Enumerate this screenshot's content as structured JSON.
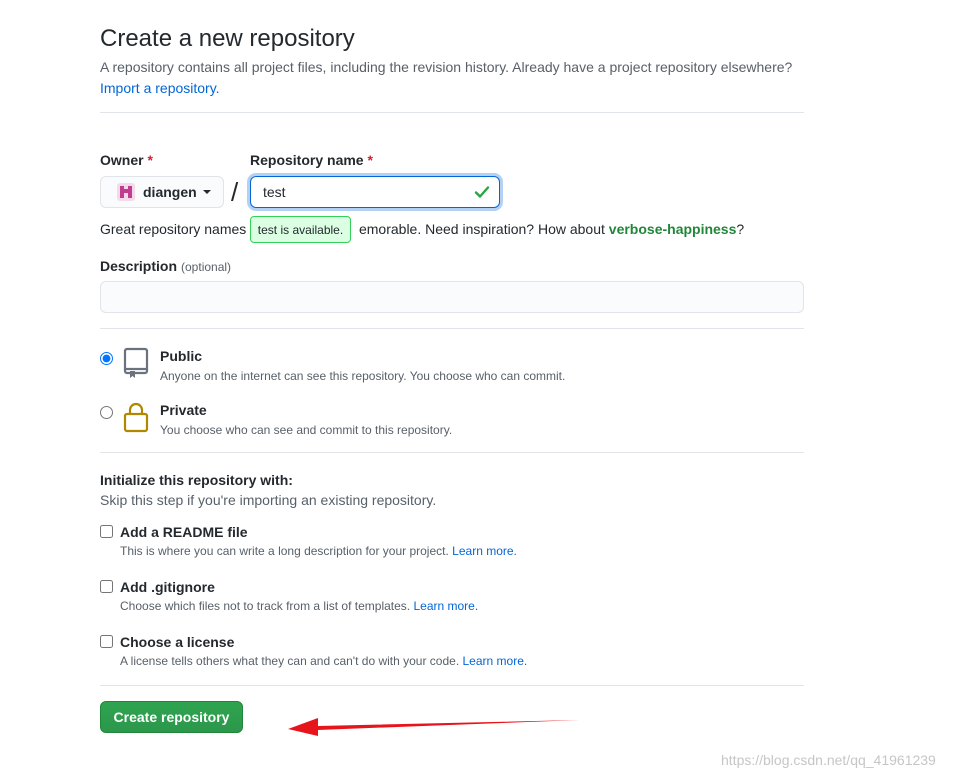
{
  "header": {
    "title": "Create a new repository",
    "subtitle": "A repository contains all project files, including the revision history. Already have a project repository elsewhere?",
    "import_link": "Import a repository."
  },
  "owner": {
    "label": "Owner",
    "required_mark": "*",
    "value": "diangen"
  },
  "repo_name": {
    "label": "Repository name",
    "required_mark": "*",
    "value": "test",
    "tooltip": "test is available."
  },
  "hint": {
    "prefix": "Great repository names a",
    "middle": "emorable. Need inspiration? How about ",
    "suggestion": "verbose-happiness",
    "suffix": "?"
  },
  "description": {
    "label": "Description",
    "optional": "(optional)",
    "value": ""
  },
  "visibility": {
    "public": {
      "title": "Public",
      "desc": "Anyone on the internet can see this repository. You choose who can commit.",
      "selected": true
    },
    "private": {
      "title": "Private",
      "desc": "You choose who can see and commit to this repository.",
      "selected": false
    }
  },
  "initialize": {
    "title": "Initialize this repository with:",
    "subtitle": "Skip this step if you're importing an existing repository.",
    "options": [
      {
        "title": "Add a README file",
        "desc": "This is where you can write a long description for your project.",
        "link": "Learn more.",
        "checked": false
      },
      {
        "title": "Add .gitignore",
        "desc": "Choose which files not to track from a list of templates.",
        "link": "Learn more.",
        "checked": false
      },
      {
        "title": "Choose a license",
        "desc": "A license tells others what they can and can't do with your code.",
        "link": "Learn more.",
        "checked": false
      }
    ]
  },
  "create_button": "Create repository",
  "watermark": "https://blog.csdn.net/qq_41961239",
  "colors": {
    "link": "#0366d6",
    "primary_button": "#2ea44f",
    "annotation_arrow": "#e8141b",
    "success": "#28a745"
  },
  "icons": {
    "owner_avatar": "identicon-avatar",
    "name_valid": "check-icon",
    "public": "repo-book-icon",
    "private": "lock-icon"
  }
}
